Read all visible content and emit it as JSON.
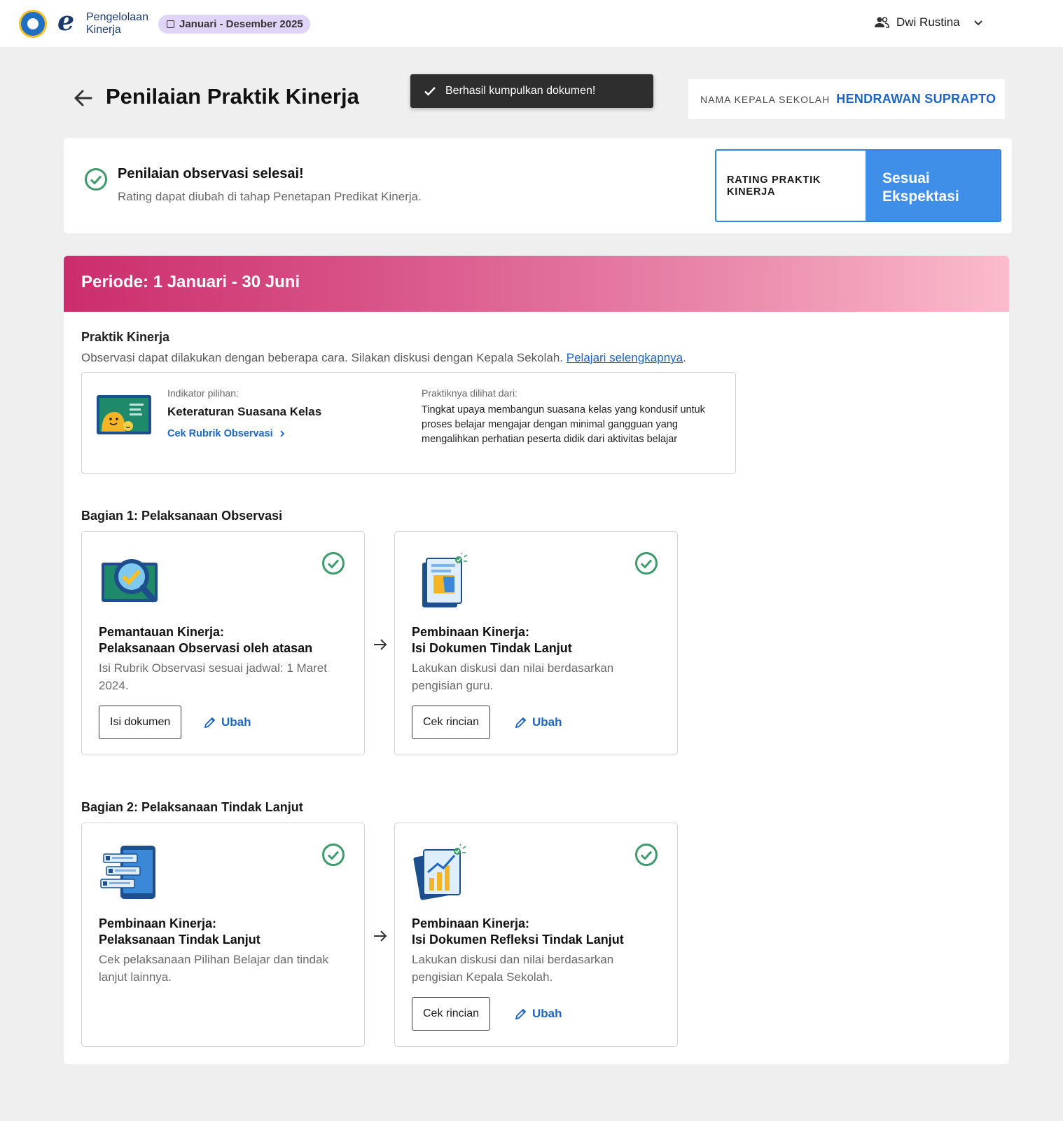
{
  "header": {
    "app_name_line1": "Pengelolaan",
    "app_name_line2": "Kinerja",
    "period_chip": "Januari - Desember 2025",
    "user_name": "Dwi Rustina"
  },
  "page": {
    "title": "Penilaian Praktik Kinerja",
    "toast": "Berhasil kumpulkan dokumen!",
    "principal_label": "NAMA KEPALA SEKOLAH",
    "principal_name": "HENDRAWAN SUPRAPTO"
  },
  "status": {
    "title": "Penilaian observasi selesai!",
    "subtitle": "Rating dapat diubah di tahap Penetapan Predikat Kinerja.",
    "rating_label_line1": "RATING PRAKTIK",
    "rating_label_line2": "KINERJA",
    "rating_value_line1": "Sesuai",
    "rating_value_line2": "Ekspektasi"
  },
  "period": {
    "title": "Periode: 1 Januari - 30 Juni"
  },
  "praktik": {
    "title": "Praktik Kinerja",
    "subtitle": "Observasi dapat dilakukan dengan beberapa cara. Silakan diskusi dengan Kepala Sekolah.",
    "link": "Pelajari selengkapnya",
    "indicator_label": "Indikator pilihan:",
    "indicator_value": "Keteraturan Suasana Kelas",
    "rubric_link": "Cek Rubrik Observasi",
    "seen_label": "Praktiknya dilihat dari:",
    "seen_value": "Tingkat upaya membangun suasana kelas yang kondusif untuk proses belajar mengajar dengan minimal gangguan yang mengalihkan perhatian peserta didik dari aktivitas belajar"
  },
  "sections": [
    {
      "title": "Bagian 1: Pelaksanaan Observasi",
      "cards": [
        {
          "title_line1": "Pemantauan Kinerja:",
          "title_line2": "Pelaksanaan Observasi oleh atasan",
          "desc": "Isi Rubrik Observasi sesuai jadwal: 1 Maret 2024.",
          "button": "Isi dokumen",
          "edit": "Ubah"
        },
        {
          "title_line1": "Pembinaan Kinerja:",
          "title_line2": "Isi Dokumen Tindak Lanjut",
          "desc": "Lakukan diskusi dan nilai berdasarkan pengisian guru.",
          "button": "Cek rincian",
          "edit": "Ubah"
        }
      ]
    },
    {
      "title": "Bagian 2: Pelaksanaan Tindak Lanjut",
      "cards": [
        {
          "title_line1": "Pembinaan Kinerja:",
          "title_line2": "Pelaksanaan Tindak Lanjut",
          "desc": "Cek pelaksanaan Pilihan Belajar dan tindak lanjut lainnya."
        },
        {
          "title_line1": "Pembinaan Kinerja:",
          "title_line2": "Isi Dokumen Refleksi Tindak Lanjut",
          "desc": "Lakukan diskusi dan nilai berdasarkan pengisian Kepala Sekolah.",
          "button": "Cek rincian",
          "edit": "Ubah"
        }
      ]
    }
  ],
  "colors": {
    "accent_blue": "#1e66c4",
    "rating_blue": "#3f8fe8",
    "success_green": "#3c9a6c",
    "period_gradient_start": "#cb2d6c",
    "period_gradient_end": "#fbbccd",
    "chip_purple": "#e0d4f7"
  },
  "icons": {
    "back": "arrow-left-icon",
    "done": "check-circle-icon",
    "edit": "pencil-icon",
    "flow": "arrow-right-icon",
    "user": "users-icon",
    "dropdown": "chevron-down-icon"
  }
}
